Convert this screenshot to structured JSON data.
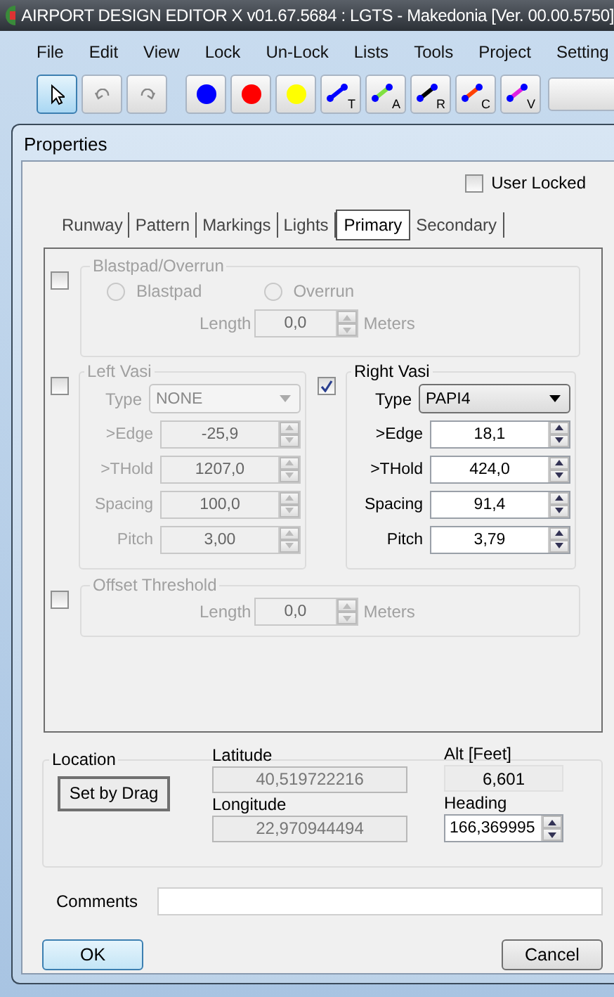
{
  "window": {
    "title": "AIRPORT DESIGN EDITOR X  v01.67.5684 : LGTS - Makedonia [Ver. 00.00.5750]"
  },
  "menu": [
    "File",
    "Edit",
    "View",
    "Lock",
    "Un-Lock",
    "Lists",
    "Tools",
    "Project",
    "Setting"
  ],
  "toolbar": {
    "tools": [
      {
        "kind": "pointer",
        "selected": true
      },
      {
        "kind": "undo",
        "selected": false
      },
      {
        "kind": "redo",
        "selected": false
      }
    ],
    "markers": [
      {
        "kind": "dot",
        "color": "#0000ff"
      },
      {
        "kind": "dot",
        "color": "#ff0000"
      },
      {
        "kind": "dot",
        "color": "#ffff00"
      },
      {
        "kind": "line",
        "letter": "T",
        "color": "#0000ff"
      },
      {
        "kind": "line",
        "letter": "A",
        "color": "#80e040"
      },
      {
        "kind": "line",
        "letter": "R",
        "color": "#000000"
      },
      {
        "kind": "line",
        "letter": "C",
        "color": "#ff4000"
      },
      {
        "kind": "line",
        "letter": "V",
        "color": "#e020e0"
      }
    ]
  },
  "dialog": {
    "title": "Properties",
    "user_locked": {
      "label": "User Locked",
      "checked": false
    },
    "tabs": [
      {
        "label": "Runway",
        "selected": false
      },
      {
        "label": "Pattern",
        "selected": false
      },
      {
        "label": "Markings",
        "selected": false
      },
      {
        "label": "Lights",
        "selected": false
      },
      {
        "label": "Primary",
        "selected": true
      },
      {
        "label": "Secondary",
        "selected": false
      }
    ],
    "blastpad": {
      "checked": false,
      "title": "Blastpad/Overrun",
      "options": [
        {
          "label": "Blastpad",
          "selected": false
        },
        {
          "label": "Overrun",
          "selected": false
        }
      ],
      "length_label": "Length",
      "length": "0,0",
      "unit": "Meters"
    },
    "vasi": [
      {
        "checked": false,
        "title": "Left Vasi",
        "type_label": "Type",
        "type": "NONE",
        "fields": [
          {
            "label": ">Edge",
            "value": "-25,9"
          },
          {
            "label": ">THold",
            "value": "1207,0"
          },
          {
            "label": "Spacing",
            "value": "100,0"
          },
          {
            "label": "Pitch",
            "value": "3,00"
          }
        ]
      },
      {
        "checked": true,
        "title": "Right Vasi",
        "type_label": "Type",
        "type": "PAPI4",
        "fields": [
          {
            "label": ">Edge",
            "value": "18,1"
          },
          {
            "label": ">THold",
            "value": "424,0"
          },
          {
            "label": "Spacing",
            "value": "91,4"
          },
          {
            "label": "Pitch",
            "value": "3,79"
          }
        ]
      }
    ],
    "offset_threshold": {
      "checked": false,
      "title": "Offset Threshold",
      "length_label": "Length",
      "length": "0,0",
      "unit": "Meters"
    },
    "location": {
      "title": "Location",
      "set_button": "Set by Drag",
      "latitude_label": "Latitude",
      "latitude": "40,519722216",
      "longitude_label": "Longitude",
      "longitude": "22,970944494",
      "alt_label": "Alt [Feet]",
      "alt": "6,601",
      "heading_label": "Heading",
      "heading": "166,369995"
    },
    "comments_label": "Comments",
    "buttons": [
      {
        "label": "OK",
        "kind": "default"
      },
      {
        "label": "Cancel",
        "kind": "normal"
      }
    ]
  }
}
